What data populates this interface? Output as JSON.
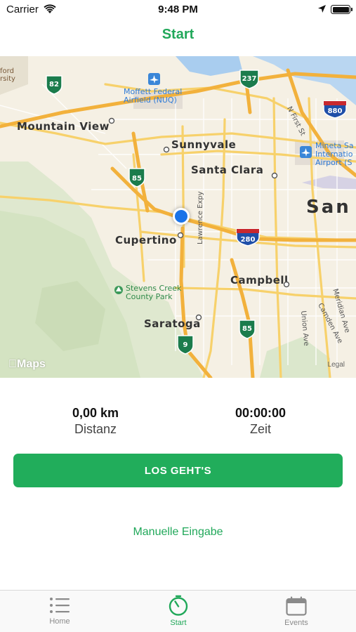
{
  "status_bar": {
    "carrier": "Carrier",
    "time": "9:48 PM"
  },
  "nav": {
    "title": "Start"
  },
  "map": {
    "labels": {
      "mountain_view": "Mountain View",
      "sunnyvale": "Sunnyvale",
      "santa_clara": "Santa Clara",
      "san": "San",
      "cupertino": "Cupertino",
      "campbell": "Campbell",
      "saratoga": "Saratoga",
      "moffett_1": "Moffett Federal",
      "moffett_2": "Airfield (NUQ)",
      "mineta_1": "Mineta Sa",
      "mineta_2": "Internatio",
      "mineta_3": "Airport (S",
      "stevens_1": "Stevens Creek",
      "stevens_2": "County Park",
      "lawrence": "Lawrence Expy",
      "first_st": "N First St",
      "union_ave": "Union Ave",
      "camden_ave": "Camden Ave",
      "meridian_ave": "Meridian Ave",
      "stanford_1": "ford",
      "stanford_2": "rsity",
      "shield_82": "82",
      "shield_237": "237",
      "shield_880": "880",
      "shield_85a": "85",
      "shield_280": "280",
      "shield_85b": "85",
      "shield_9": "9"
    },
    "logo": "Maps",
    "legal": "Legal"
  },
  "stats": {
    "distance_value": "0,00 km",
    "distance_label": "Distanz",
    "time_value": "00:00:00",
    "time_label": "Zeit"
  },
  "actions": {
    "start_button": "LOS GEHT'S",
    "manual_entry": "Manuelle Eingabe"
  },
  "tabs": [
    {
      "label": "Home",
      "icon": "list-icon",
      "active": false
    },
    {
      "label": "Start",
      "icon": "stopwatch-icon",
      "active": true
    },
    {
      "label": "Events",
      "icon": "calendar-icon",
      "active": false
    }
  ],
  "colors": {
    "accent": "#21a85a",
    "button": "#21ad5b",
    "location": "#1a73e8"
  }
}
